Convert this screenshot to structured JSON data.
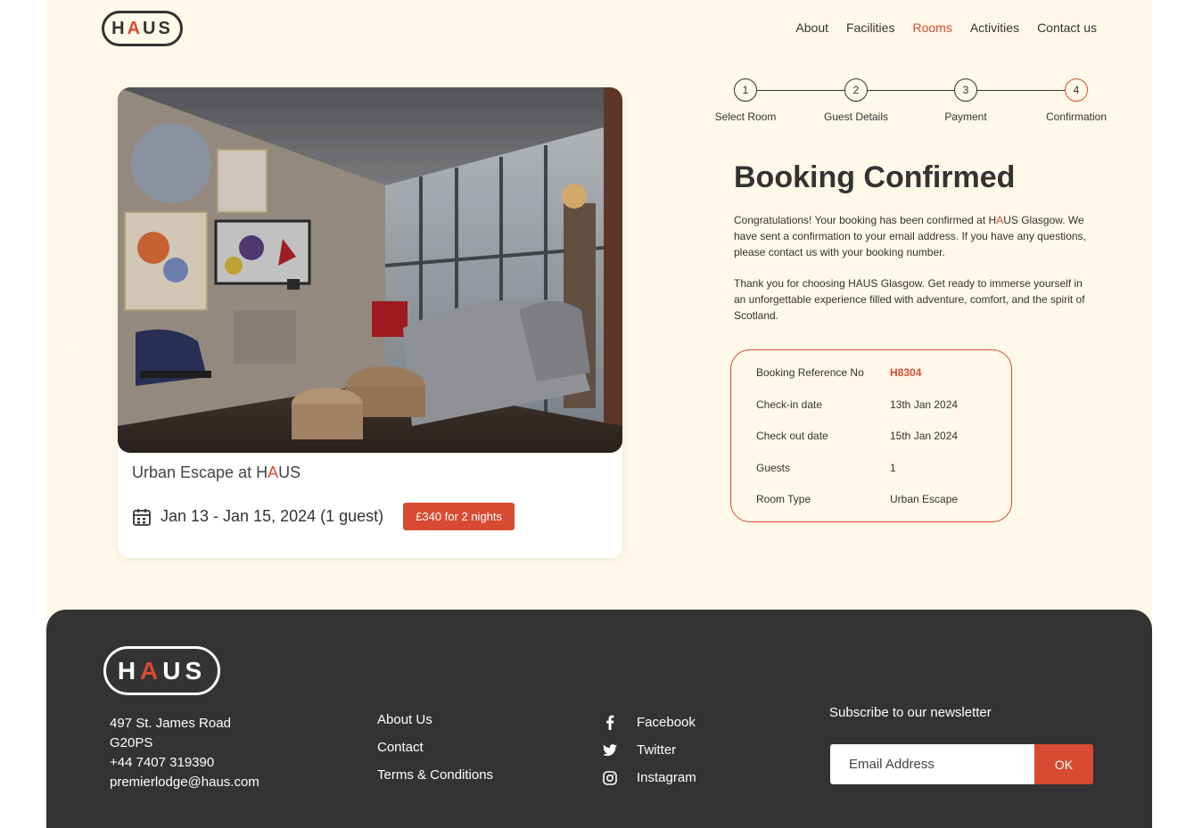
{
  "brand": {
    "logo_pre": "H",
    "logo_accent": "A",
    "logo_post": "US",
    "accent_color": "#d94a32"
  },
  "nav": {
    "items": [
      {
        "label": "About"
      },
      {
        "label": "Facilities"
      },
      {
        "label": "Rooms",
        "active": true
      },
      {
        "label": "Activities"
      },
      {
        "label": "Contact us"
      }
    ]
  },
  "room_card": {
    "title_pre": "Urban Escape at ",
    "title_brand_pre": "H",
    "title_brand_accent": "A",
    "title_brand_post": "US",
    "dates": "Jan 13 - Jan 15, 2024 (1 guest)",
    "price": "£340 for 2 nights",
    "prev_arrow": "←",
    "photo_icon": "living-room-photo"
  },
  "steps": [
    {
      "number": "1",
      "label": "Select Room"
    },
    {
      "number": "2",
      "label": "Guest Details"
    },
    {
      "number": "3",
      "label": "Payment"
    },
    {
      "number": "4",
      "label": "Confirmation",
      "current": true
    }
  ],
  "confirmation": {
    "heading": "Booking Confirmed",
    "msg1_pre": "Congratulations! Your booking has been confirmed at H",
    "msg1_accent": "A",
    "msg1_post": "US Glasgow. We have sent a confirmation to your email address. If you have any questions, please contact us with your booking number.",
    "msg2": "Thank you for choosing HAUS Glasgow. Get ready to immerse yourself in an unforgettable experience filled with adventure, comfort, and the spirit of Scotland."
  },
  "details": [
    {
      "key": "Booking Reference No",
      "value": "H8304"
    },
    {
      "key": "Check-in date",
      "value": "13th Jan 2024"
    },
    {
      "key": "Check out date",
      "value": "15th Jan 2024"
    },
    {
      "key": "Guests",
      "value": "1"
    },
    {
      "key": "Room Type",
      "value": "Urban Escape"
    }
  ],
  "footer": {
    "address": [
      "497 St. James Road",
      "G20PS",
      "+44 7407 319390",
      "premierlodge@haus.com"
    ],
    "links": [
      "About Us",
      "Contact",
      "Terms & Conditions"
    ],
    "social": [
      {
        "label": "Facebook",
        "icon": "facebook-icon"
      },
      {
        "label": "Twitter",
        "icon": "twitter-icon"
      },
      {
        "label": "Instagram",
        "icon": "instagram-icon"
      }
    ],
    "newsletter_title": "Subscribe to our newsletter",
    "email_placeholder": "Email Address",
    "ok_label": "OK"
  }
}
